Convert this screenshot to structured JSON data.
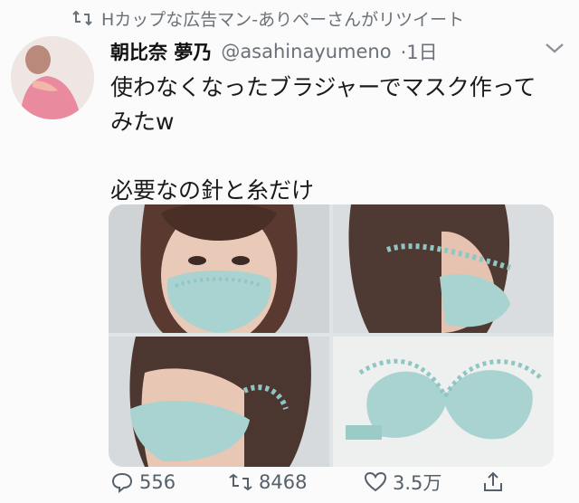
{
  "retweet_banner": {
    "icon": "retweet-icon",
    "text": "Hカップな広告マン-ありぺーさんがリツイート"
  },
  "tweet": {
    "display_name": "朝比奈 夢乃",
    "handle": "@asahinayumeno",
    "time": "·1日",
    "text_lines": [
      "使わなくなったブラジャーでマスク作って",
      "みたw"
    ],
    "text_line_2": "必要なの針と糸だけ"
  },
  "actions": {
    "reply_count": "556",
    "retweet_count": "8468",
    "like_count": "3.5万"
  },
  "colors": {
    "mask": "#a9d3d0",
    "lace": "#8fc6c4",
    "muted": "#6b7178"
  }
}
